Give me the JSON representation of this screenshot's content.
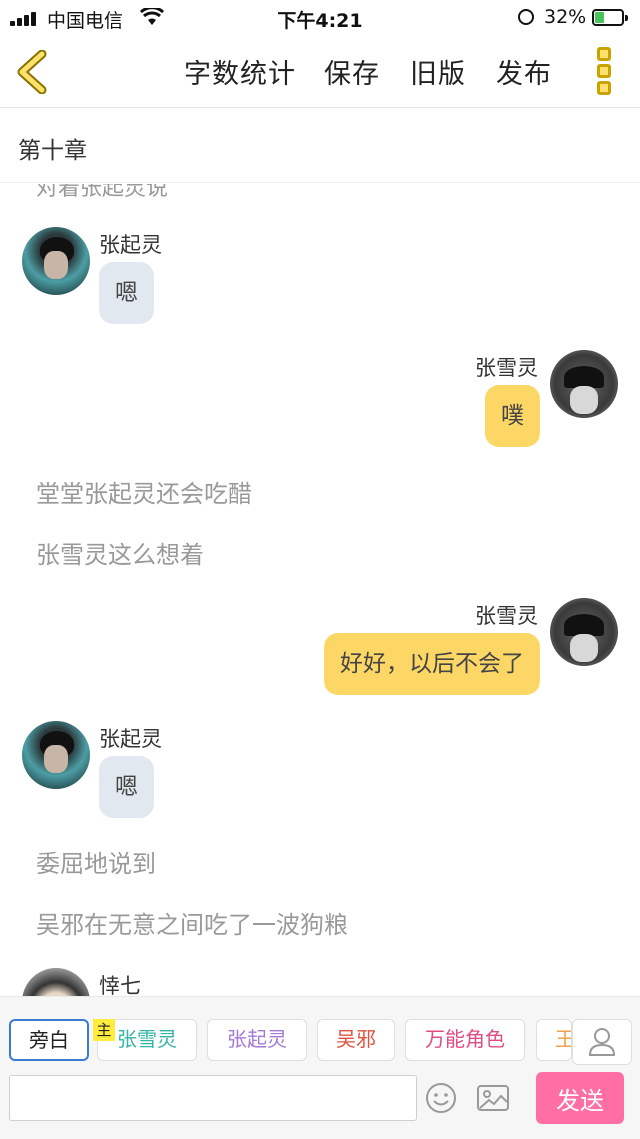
{
  "status_bar": {
    "carrier": "中国电信",
    "time": "下午4:21",
    "battery": "32%"
  },
  "nav": {
    "word_count": "字数统计",
    "save": "保存",
    "old_version": "旧版",
    "publish": "发布"
  },
  "chapter_title": "第十章",
  "chat": {
    "partial_line": "对着张起灵说",
    "messages": [
      {
        "speaker": "张起灵",
        "text": "嗯"
      },
      {
        "speaker": "张雪灵",
        "text": "噗"
      },
      {
        "narration": "堂堂张起灵还会吃醋"
      },
      {
        "narration": "张雪灵这么想着"
      },
      {
        "speaker": "张雪灵",
        "text": "好好，以后不会了"
      },
      {
        "speaker": "张起灵",
        "text": "嗯"
      },
      {
        "narration": "委屈地说到"
      },
      {
        "narration": "吴邪在无意之间吃了一波狗粮"
      },
      {
        "speaker": "悻七"
      }
    ]
  },
  "roles": {
    "narrator": "旁白",
    "host_badge": "主",
    "chips": [
      "张雪灵",
      "张起灵",
      "吴邪",
      "万能角色",
      "王"
    ],
    "chip_colors": [
      "#33b5a5",
      "#a678d6",
      "#e0533f",
      "#e04e80",
      "#f0a14a"
    ]
  },
  "composer": {
    "placeholder": "",
    "send": "发送"
  },
  "colors": {
    "send_button": "#ff6fa5",
    "self_bubble": "#fdd766",
    "other_bubble": "#e1e8ef"
  }
}
